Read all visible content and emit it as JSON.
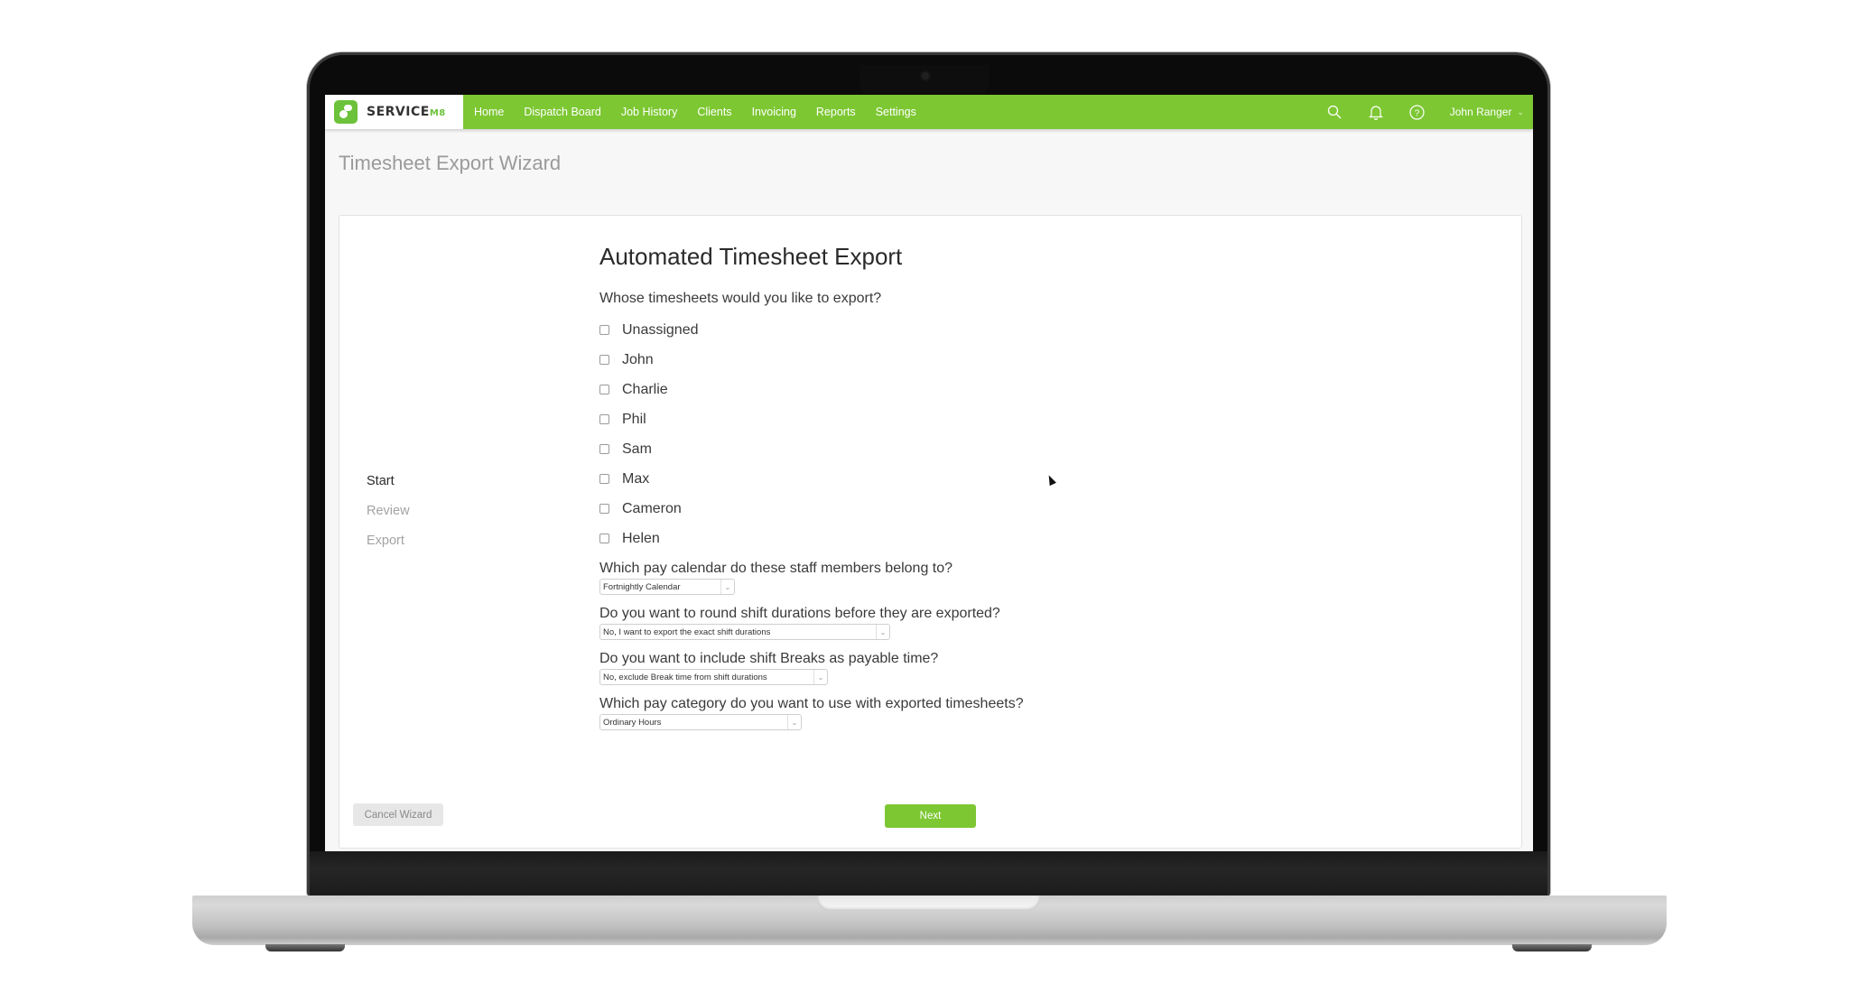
{
  "app": {
    "brand": "SERVICE",
    "brand_suffix": "M8",
    "nav": [
      "Home",
      "Dispatch Board",
      "Job History",
      "Clients",
      "Invoicing",
      "Reports",
      "Settings"
    ],
    "icons": [
      "search-icon",
      "bell-icon",
      "help-icon"
    ],
    "user": "John Ranger",
    "accent_color": "#7dc733"
  },
  "page": {
    "title": "Timesheet Export Wizard"
  },
  "wizard": {
    "steps": [
      {
        "label": "Start",
        "active": true
      },
      {
        "label": "Review",
        "active": false
      },
      {
        "label": "Export",
        "active": false
      }
    ],
    "heading": "Automated Timesheet Export",
    "staff_question": "Whose timesheets would you like to export?",
    "staff": [
      {
        "name": "Unassigned",
        "checked": false
      },
      {
        "name": "John",
        "checked": false
      },
      {
        "name": "Charlie",
        "checked": false
      },
      {
        "name": "Phil",
        "checked": false
      },
      {
        "name": "Sam",
        "checked": false
      },
      {
        "name": "Max",
        "checked": false
      },
      {
        "name": "Cameron",
        "checked": false
      },
      {
        "name": "Helen",
        "checked": false
      }
    ],
    "selects": [
      {
        "question": "Which pay calendar do these staff members belong to?",
        "value": "Fortnightly Calendar"
      },
      {
        "question": "Do you want to round shift durations before they are exported?",
        "value": "No, I want to export the exact shift durations"
      },
      {
        "question": "Do you want to include shift Breaks as payable time?",
        "value": "No, exclude Break time from shift durations"
      },
      {
        "question": "Which pay category do you want to use with exported timesheets?",
        "value": "Ordinary Hours"
      }
    ],
    "cancel_label": "Cancel Wizard",
    "next_label": "Next"
  }
}
